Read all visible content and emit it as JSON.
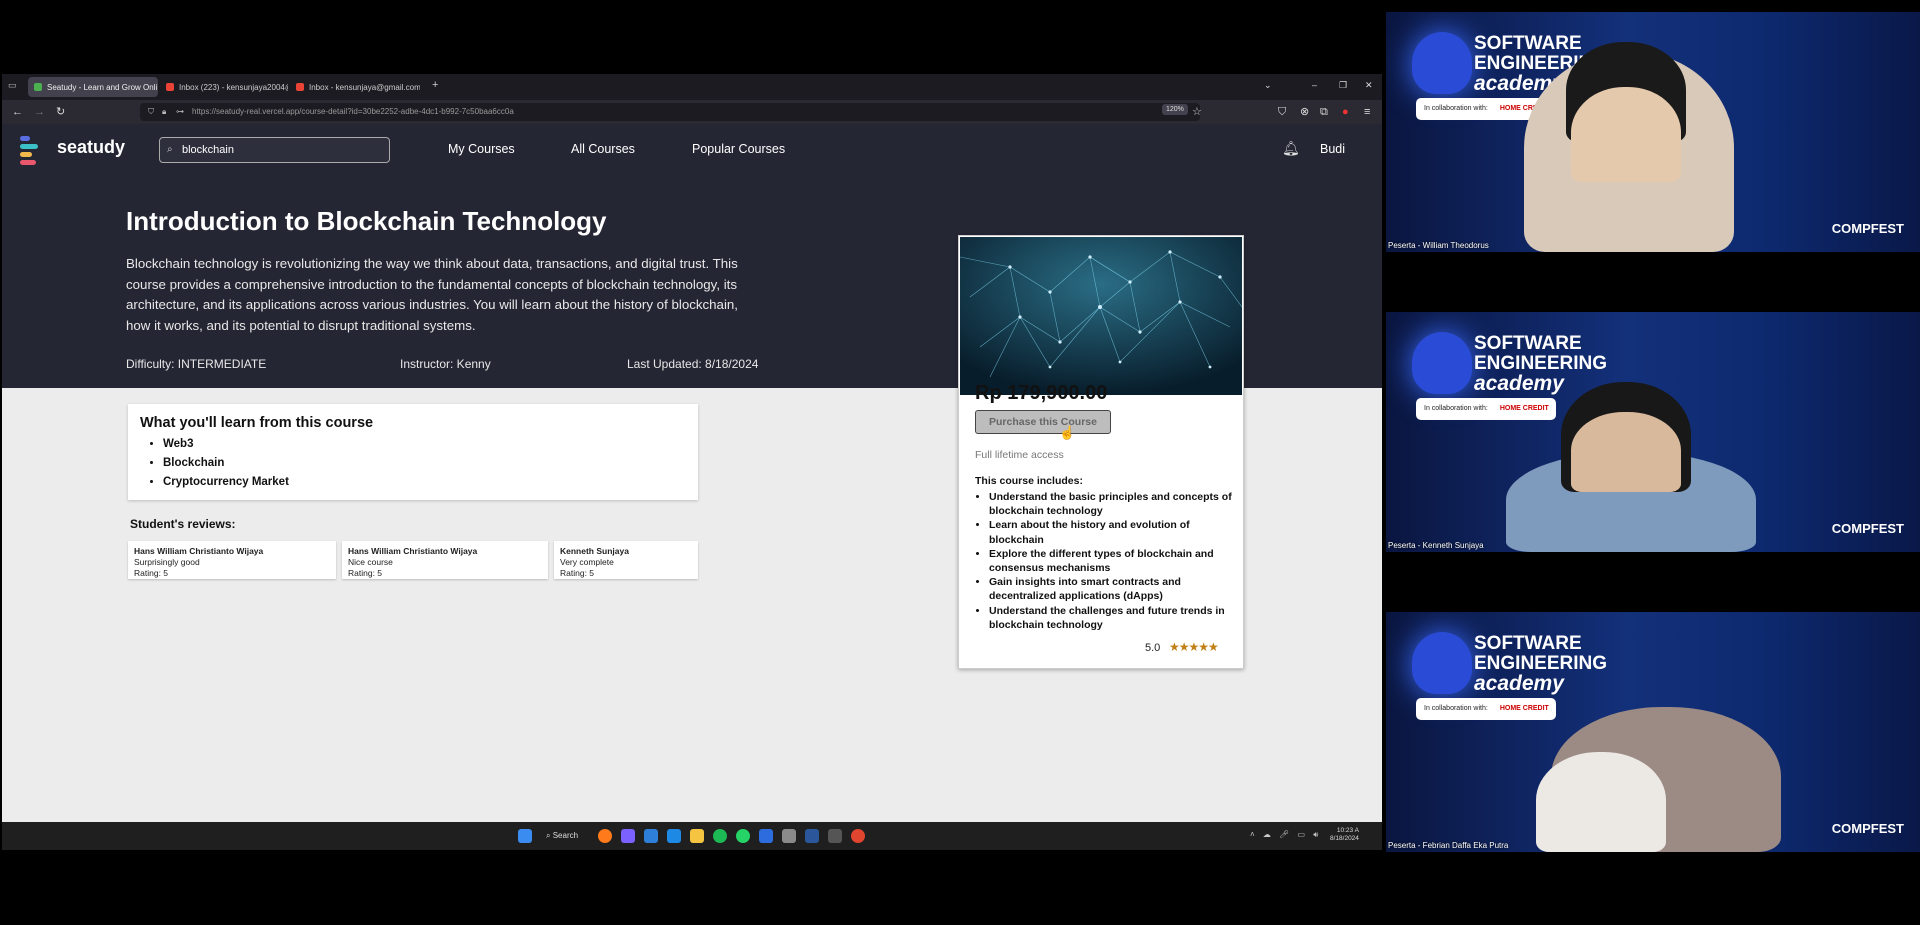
{
  "browser": {
    "tabs": [
      {
        "label": "Seatudy - Learn and Grow Onli",
        "active": true,
        "favicon_color": "#4caf50"
      },
      {
        "label": "Inbox (223) - kensunjaya2004@",
        "active": false,
        "favicon_color": "#ea4335"
      },
      {
        "label": "Inbox - kensunjaya@gmail.com",
        "active": false,
        "favicon_color": "#ea4335"
      }
    ],
    "new_tab": "+",
    "url": "https://seatudy-real.vercel.app/course-detail?id=30be2252-adbe-4dc1-b992-7c50baa6cc0a",
    "zoom": "120%"
  },
  "app": {
    "logo_text": "seatudy",
    "logo_colors": [
      "#5b6ee1",
      "#3cc0c7",
      "#f2b84b",
      "#e8576b"
    ],
    "search_value": "blockchain",
    "nav": [
      "My Courses",
      "All Courses",
      "Popular Courses"
    ],
    "user": "Budi"
  },
  "course": {
    "title": "Introduction to Blockchain Technology",
    "description": "Blockchain technology is revolutionizing the way we think about data, transactions, and digital trust. This course provides a comprehensive introduction to the fundamental concepts of blockchain technology, its architecture, and its applications across various industries. You will learn about the history of blockchain, how it works, and its potential to disrupt traditional systems.",
    "difficulty": "Difficulty: INTERMEDIATE",
    "instructor": "Instructor: Kenny",
    "last_updated": "Last Updated: 8/18/2024",
    "learn_title": "What you'll learn from this course",
    "learn_items": [
      "Web3",
      "Blockchain",
      "Cryptocurrency Market"
    ],
    "reviews_title": "Student's reviews:",
    "reviews": [
      {
        "name": "Hans William Christianto Wijaya",
        "text": "Surprisingly good",
        "rating": "Rating: 5"
      },
      {
        "name": "Hans William Christianto Wijaya",
        "text": "Nice course",
        "rating": "Rating: 5"
      },
      {
        "name": "Kenneth Sunjaya",
        "text": "Very complete",
        "rating": "Rating: 5"
      }
    ],
    "price": "Rp 179,900.00",
    "purchase_label": "Purchase this Course",
    "lifetime": "Full lifetime access",
    "includes_title": "This course includes:",
    "includes": [
      "Understand the basic principles and concepts of blockchain technology",
      "Learn about the history and evolution of blockchain",
      "Explore the different types of blockchain and consensus mechanisms",
      "Gain insights into smart contracts and decentralized applications (dApps)",
      "Understand the challenges and future trends in blockchain technology"
    ],
    "rating_value": "5.0",
    "stars": "★★★★★",
    "star_count": 5
  },
  "taskbar": {
    "search_label": "Search",
    "clock_time": "10:23 A",
    "clock_date": "8/18/2024"
  },
  "participants": [
    {
      "name": "Peserta - William Theodorus"
    },
    {
      "name": "Peserta - Kenneth Sunjaya"
    },
    {
      "name": "Peserta - Febrian Daffa Eka Putra"
    }
  ],
  "branding": {
    "line1": "SOFTWARE",
    "line2": "ENGINEERING",
    "line3": "academy",
    "collab": "In collaboration with:",
    "partner": "HOME CREDIT",
    "compfest": "COMPFEST"
  }
}
